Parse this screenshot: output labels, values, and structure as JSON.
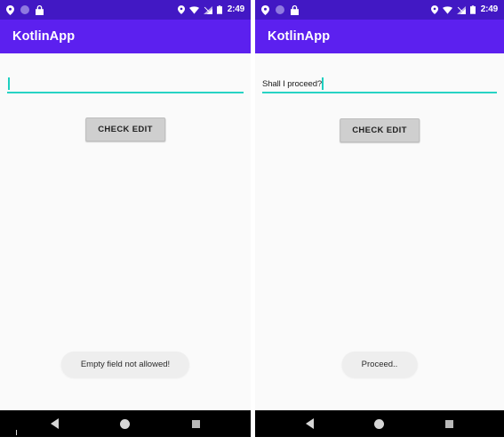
{
  "screen": {
    "colors": {
      "status_bar": "#4218c4",
      "app_bar": "#5c20ef",
      "background": "#fafafa",
      "accent_teal": "#27d3c4",
      "button_gray": "#cfcfcf",
      "toast_gray": "#eeeeee",
      "nav_bar": "#000000"
    }
  },
  "panels": [
    {
      "id": "left",
      "status_bar": {
        "left_icons": [
          "location-pin-icon",
          "circle-icon",
          "lock-icon"
        ],
        "right_icons": [
          "location-pin-icon",
          "wifi-icon",
          "cellular-signal-icon",
          "battery-icon"
        ],
        "clock": "2:49"
      },
      "app_bar": {
        "title": "KotlinApp"
      },
      "edit_text": {
        "value": "",
        "placeholder": "",
        "caret_visible": true
      },
      "button": {
        "label": "CHECK EDIT"
      },
      "toast": {
        "message": "Empty field not allowed!"
      },
      "nav_bar": {
        "back": "back-nav-icon",
        "home": "home-nav-icon",
        "recents": "recents-nav-icon"
      }
    },
    {
      "id": "right",
      "status_bar": {
        "left_icons": [
          "location-pin-icon",
          "circle-icon",
          "lock-icon"
        ],
        "right_icons": [
          "location-pin-icon",
          "wifi-icon",
          "cellular-signal-icon",
          "battery-icon"
        ],
        "clock": "2:49"
      },
      "app_bar": {
        "title": "KotlinApp"
      },
      "edit_text": {
        "value": "Shall I proceed?",
        "placeholder": "",
        "caret_visible": true
      },
      "button": {
        "label": "CHECK EDIT"
      },
      "toast": {
        "message": "Proceed.."
      },
      "nav_bar": {
        "back": "back-nav-icon",
        "home": "home-nav-icon",
        "recents": "recents-nav-icon"
      }
    }
  ]
}
